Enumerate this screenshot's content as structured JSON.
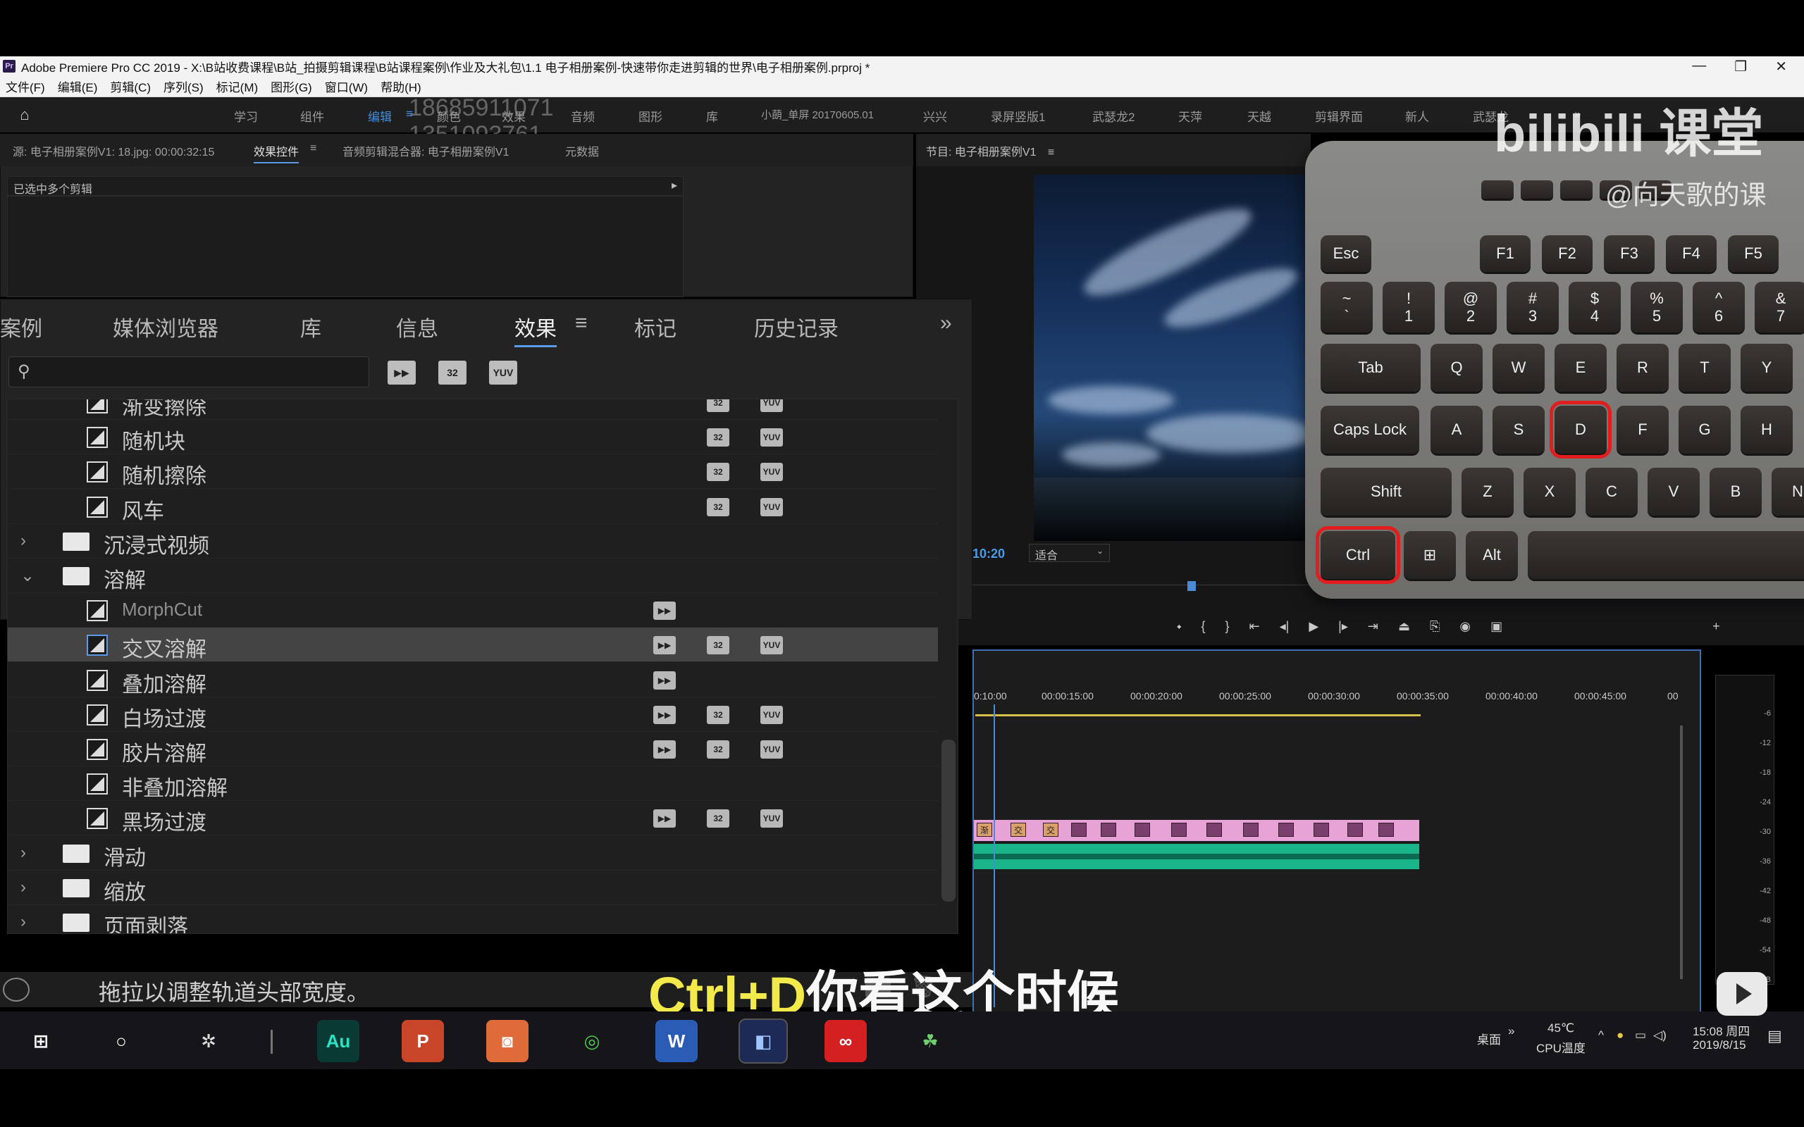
{
  "window": {
    "title": "Adobe Premiere Pro CC 2019 - X:\\B站收费课程\\B站_拍摄剪辑课程\\B站课程案例\\作业及大礼包\\1.1 电子相册案例-快速带你走进剪辑的世界\\电子相册案例.prproj *",
    "controls": [
      "—",
      "❐",
      "✕"
    ]
  },
  "menu": [
    "文件(F)",
    "编辑(E)",
    "剪辑(C)",
    "序列(S)",
    "标记(M)",
    "图形(G)",
    "窗口(W)",
    "帮助(H)"
  ],
  "workspaces": [
    "学习",
    "组件",
    "编辑",
    "颜色",
    "效果",
    "音频",
    "图形",
    "库",
    "小蓢_单屏 20170605.01",
    "兴兴",
    "录屏竖版1",
    "武瑟龙2",
    "天萍",
    "天越",
    "剪辑界面",
    "新人",
    "武瑟龙"
  ],
  "workspace_more": "»",
  "watermark_phone": "18685911071\n1351093761",
  "source_tabs": {
    "source": "源: 电子相册案例V1: 18.jpg: 00:00:32:15",
    "effect_controls": "效果控件",
    "audio_mixer": "音频剪辑混合器: 电子相册案例V1",
    "metadata": "元数据",
    "menu_glyph": "≡"
  },
  "multi_clip_label": "已选中多个剪辑",
  "program": {
    "title": "节目: 电子相册案例V1",
    "menu_glyph": "≡",
    "timecode": "10:20",
    "fit": "适合"
  },
  "fx_tabs": [
    "案例",
    "媒体浏览器",
    "库",
    "信息",
    "效果",
    "标记",
    "历史记录"
  ],
  "fx_tab_menu": "≡",
  "fx_more": "»",
  "fx_filters": [
    "▶▶",
    "32",
    "YUV"
  ],
  "fx_rows": [
    {
      "type": "effect",
      "label": "渐变擦除",
      "badges": [
        "32",
        "YUV"
      ],
      "partial": true
    },
    {
      "type": "effect",
      "label": "随机块",
      "badges": [
        "32",
        "YUV"
      ]
    },
    {
      "type": "effect",
      "label": "随机擦除",
      "badges": [
        "32",
        "YUV"
      ]
    },
    {
      "type": "effect",
      "label": "风车",
      "badges": [
        "32",
        "YUV"
      ]
    },
    {
      "type": "folder",
      "label": "沉浸式视频",
      "expanded": false
    },
    {
      "type": "folder",
      "label": "溶解",
      "expanded": true
    },
    {
      "type": "effect",
      "label": "MorphCut",
      "badges": [
        "accel"
      ],
      "dim": true
    },
    {
      "type": "effect",
      "label": "交叉溶解",
      "badges": [
        "accel",
        "32",
        "YUV"
      ],
      "selected": true
    },
    {
      "type": "effect",
      "label": "叠加溶解",
      "badges": [
        "accel"
      ]
    },
    {
      "type": "effect",
      "label": "白场过渡",
      "badges": [
        "accel",
        "32",
        "YUV"
      ]
    },
    {
      "type": "effect",
      "label": "胶片溶解",
      "badges": [
        "accel",
        "32",
        "YUV"
      ]
    },
    {
      "type": "effect",
      "label": "非叠加溶解",
      "badges": []
    },
    {
      "type": "effect",
      "label": "黑场过渡",
      "badges": [
        "accel",
        "32",
        "YUV"
      ]
    },
    {
      "type": "folder",
      "label": "滑动",
      "expanded": false
    },
    {
      "type": "folder",
      "label": "缩放",
      "expanded": false
    },
    {
      "type": "folder",
      "label": "页面剥落",
      "expanded": false
    }
  ],
  "status_text": "拖拉以调整轨道头部宽度。",
  "timeline": {
    "ruler": [
      "0:10:00",
      "00:00:15:00",
      "00:00:20:00",
      "00:00:25:00",
      "00:00:30:00",
      "00:00:35:00",
      "00:00:40:00",
      "00:00:45:00",
      "00"
    ],
    "clip_labels": [
      "渐",
      "交",
      "交"
    ],
    "meter_scale": [
      "-6",
      "-12",
      "-18",
      "-24",
      "-30",
      "-36",
      "-42",
      "-48",
      "-54",
      "dB"
    ]
  },
  "subtitle": {
    "highlight": "Ctrl+D",
    "rest": "你看这个时候"
  },
  "keyboard": {
    "fn_row": [
      "Esc",
      "F1",
      "F2",
      "F3",
      "F4",
      "F5"
    ],
    "num_row": [
      "~\n`",
      "!\n1",
      "@\n2",
      "#\n3",
      "$\n4",
      "%\n5",
      "^\n6",
      "&\n7"
    ],
    "q_row": [
      "Tab",
      "Q",
      "W",
      "E",
      "R",
      "T",
      "Y"
    ],
    "a_row": [
      "Caps Lock",
      "A",
      "S",
      "D",
      "F",
      "G",
      "H"
    ],
    "z_row": [
      "Shift",
      "Z",
      "X",
      "C",
      "V",
      "B",
      "N"
    ],
    "bottom_row": [
      "Ctrl",
      "⊞",
      "Alt",
      ""
    ],
    "highlighted": [
      "Ctrl",
      "D"
    ],
    "highlight_color": "#e11d1d"
  },
  "brand": {
    "logo": "bilibili 课堂",
    "user": "@向天歌的课"
  },
  "taskbar": {
    "apps": [
      "start",
      "cortana",
      "fan",
      "Au",
      "P",
      "photo",
      "wechat",
      "W",
      "premiere",
      "creative-cloud",
      "clover"
    ],
    "desktop": "桌面",
    "temp": "45℃",
    "temp_label": "CPU温度",
    "time": "15:08 周四",
    "date": "2019/8/15"
  }
}
